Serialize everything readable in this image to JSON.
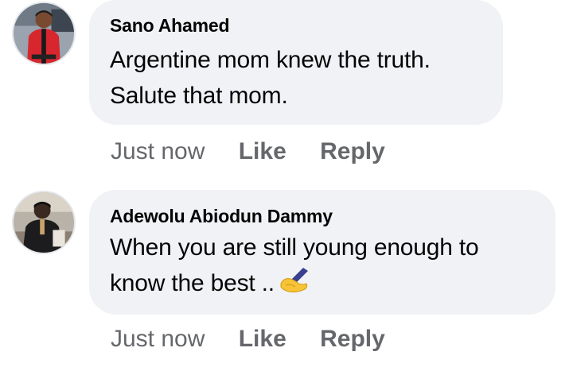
{
  "comments": [
    {
      "author": "Sano Ahamed",
      "text_lines": [
        "Argentine mom knew the truth.",
        "Salute that mom."
      ],
      "timestamp": "Just now",
      "like_label": "Like",
      "reply_label": "Reply",
      "avatar_icon": "profile-photo-red-shirt"
    },
    {
      "author": "Adewolu Abiodun Dammy",
      "text_lines": [
        "When you are  still young enough to",
        "know the best .."
      ],
      "emoji": "writing-hand-emoji",
      "timestamp": "Just now",
      "like_label": "Like",
      "reply_label": "Reply",
      "avatar_icon": "profile-photo-dark-shirt"
    }
  ],
  "colors": {
    "bubble": "#f0f2f5",
    "text": "#050505",
    "meta": "#65676b"
  }
}
